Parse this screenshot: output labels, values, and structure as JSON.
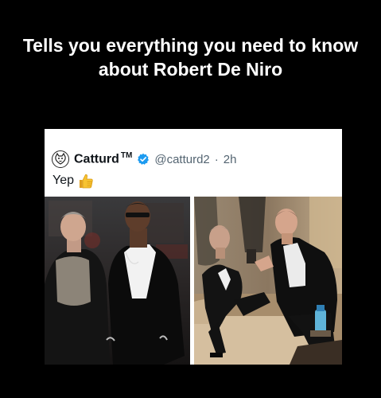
{
  "caption": "Tells you everything you need to know about Robert De Niro",
  "tweet": {
    "display_name": "Catturd",
    "tm": "TM",
    "handle": "@catturd2",
    "separator": "·",
    "time": "2h",
    "text": "Yep",
    "emoji": "thumbs-up-icon"
  },
  "colors": {
    "verified": "#1d9bf0",
    "handle": "#536471",
    "thumb": "#f7c331"
  }
}
